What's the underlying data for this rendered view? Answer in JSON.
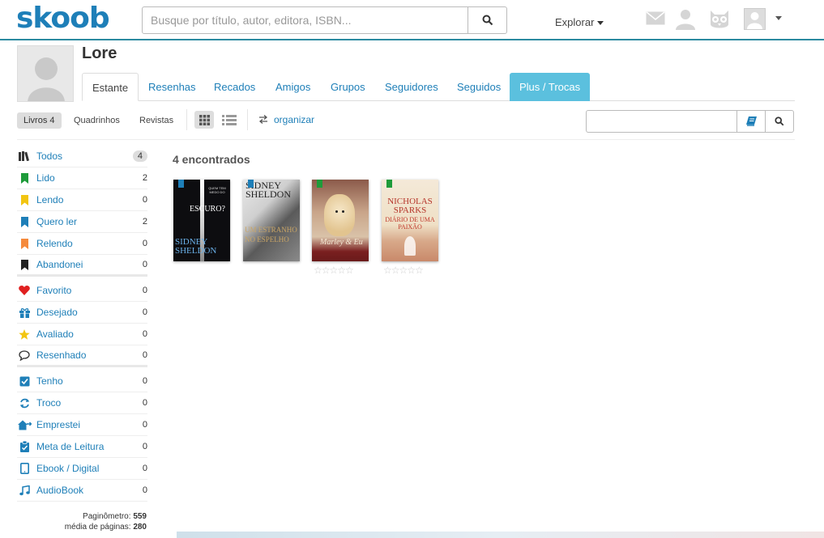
{
  "header": {
    "logo": "skoob",
    "search_placeholder": "Busque por título, autor, editora, ISBN...",
    "explore_label": "Explorar"
  },
  "profile": {
    "name": "Lore",
    "tabs": [
      {
        "label": "Estante",
        "active": true
      },
      {
        "label": "Resenhas"
      },
      {
        "label": "Recados"
      },
      {
        "label": "Amigos"
      },
      {
        "label": "Grupos"
      },
      {
        "label": "Seguidores"
      },
      {
        "label": "Seguidos"
      },
      {
        "label": "Plus / Trocas",
        "highlight": true
      }
    ]
  },
  "filters": {
    "livros": "Livros 4",
    "quadrinhos": "Quadrinhos",
    "revistas": "Revistas",
    "organizar": "organizar"
  },
  "sidebar": {
    "items": [
      {
        "label": "Todos",
        "count": "4",
        "icon": "books-icon",
        "color": "#333333"
      },
      {
        "label": "Lido",
        "count": "2",
        "icon": "bookmark-icon",
        "color": "#1e9b3a"
      },
      {
        "label": "Lendo",
        "count": "0",
        "icon": "bookmark-icon",
        "color": "#f2c511"
      },
      {
        "label": "Quero ler",
        "count": "2",
        "icon": "bookmark-icon",
        "color": "#1e7fb8"
      },
      {
        "label": "Relendo",
        "count": "0",
        "icon": "bookmark-icon",
        "color": "#f58a3c"
      },
      {
        "label": "Abandonei",
        "count": "0",
        "icon": "bookmark-icon",
        "color": "#222222"
      },
      {
        "label": "Favorito",
        "count": "0",
        "icon": "heart-icon",
        "color": "#e02020"
      },
      {
        "label": "Desejado",
        "count": "0",
        "icon": "gift-icon",
        "color": "#1e7fb8"
      },
      {
        "label": "Avaliado",
        "count": "0",
        "icon": "star-icon",
        "color": "#f2c511"
      },
      {
        "label": "Resenhado",
        "count": "0",
        "icon": "comment-icon",
        "color": "#333333"
      },
      {
        "label": "Tenho",
        "count": "0",
        "icon": "check-square-icon",
        "color": "#1e7fb8"
      },
      {
        "label": "Troco",
        "count": "0",
        "icon": "refresh-icon",
        "color": "#1e7fb8"
      },
      {
        "label": "Emprestei",
        "count": "0",
        "icon": "home-arrow-icon",
        "color": "#1e7fb8"
      },
      {
        "label": "Meta de Leitura",
        "count": "0",
        "icon": "clipboard-icon",
        "color": "#1e7fb8"
      },
      {
        "label": "Ebook / Digital",
        "count": "0",
        "icon": "tablet-icon",
        "color": "#1e7fb8"
      },
      {
        "label": "AudioBook",
        "count": "0",
        "icon": "music-icon",
        "color": "#1e7fb8"
      }
    ],
    "pagination_label": "Paginômetro:",
    "pagination_value": "559",
    "average_label": "média de páginas:",
    "average_value": "280"
  },
  "main": {
    "found": "4 encontrados",
    "books": [
      {
        "title_line1": "QUEM TEM MEDO DO",
        "title_line2": "ESCURO?",
        "author": "SIDNEY SHELDON",
        "flag": "#1e7fb8"
      },
      {
        "author": "SIDNEY SHELDON",
        "title": "UM ESTRANHO NO ESPELHO",
        "flag": "#1e7fb8"
      },
      {
        "title": "Marley & Eu",
        "flag": "#1e9b3a"
      },
      {
        "author": "NICHOLAS SPARKS",
        "title": "DIÁRIO DE UMA PAIXÃO",
        "flag": "#1e9b3a"
      }
    ]
  }
}
